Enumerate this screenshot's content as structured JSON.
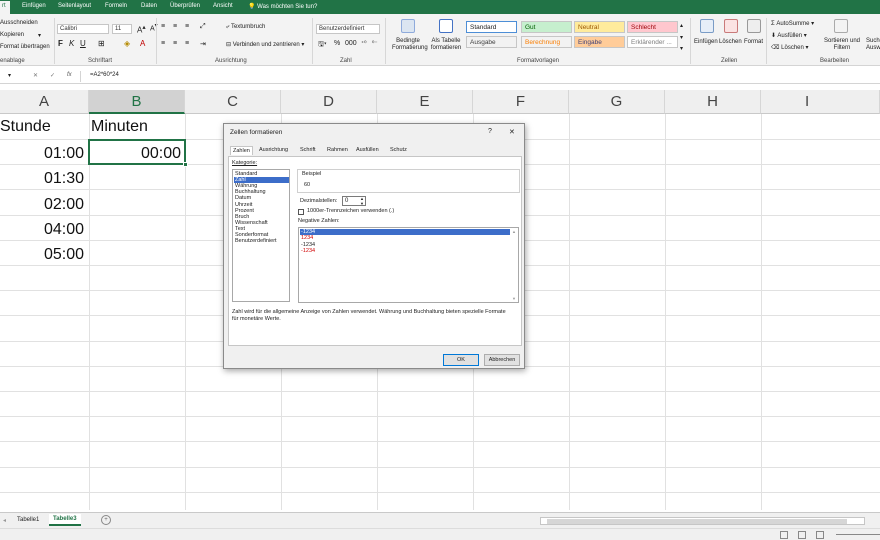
{
  "ribbon_tabs": [
    "rt",
    "Einfügen",
    "Seitenlayout",
    "Formeln",
    "Daten",
    "Überprüfen",
    "Ansicht"
  ],
  "tell_me": "Was möchten Sie tun?",
  "clipboard": {
    "cut": "Ausschneiden",
    "copy": "Kopieren",
    "format_painter": "Format übertragen",
    "label": "enablage"
  },
  "font": {
    "name": "Calibri",
    "size": "11",
    "label": "Schriftart"
  },
  "alignment": {
    "wrap": "Textumbruch",
    "merge": "Verbinden und zentrieren",
    "label": "Ausrichtung"
  },
  "number": {
    "format": "Benutzerdefiniert",
    "label": "Zahl"
  },
  "styles": {
    "conditional": "Bedingte Formatierung",
    "as_table": "Als Tabelle formatieren",
    "cells": [
      {
        "name": "Standard",
        "bg": "#ffffff",
        "fg": "#222222"
      },
      {
        "name": "Gut",
        "bg": "#c6efce",
        "fg": "#006100"
      },
      {
        "name": "Neutral",
        "bg": "#ffeb9c",
        "fg": "#9c5700"
      },
      {
        "name": "Schlecht",
        "bg": "#ffc7ce",
        "fg": "#9c0006"
      },
      {
        "name": "Ausgabe",
        "bg": "#f2f2f2",
        "fg": "#3f3f3f"
      },
      {
        "name": "Berechnung",
        "bg": "#f2f2f2",
        "fg": "#fa7d00"
      },
      {
        "name": "Eingabe",
        "bg": "#ffcc99",
        "fg": "#3f3f76"
      },
      {
        "name": "Erklärender ...",
        "bg": "#ffffff",
        "fg": "#7f7f7f"
      }
    ],
    "label": "Formatvorlagen"
  },
  "cells_group": {
    "insert": "Einfügen",
    "delete": "Löschen",
    "format": "Format",
    "label": "Zellen"
  },
  "editing": {
    "autosum": "AutoSumme",
    "fill": "Ausfüllen",
    "clear": "Löschen",
    "sort": "Sortieren und Filtern",
    "find": "Suche Ausw",
    "label": "Bearbeiten"
  },
  "formula_bar": {
    "formula": "=A2*60*24",
    "fx": "fx"
  },
  "columns": [
    "A",
    "B",
    "C",
    "D",
    "E",
    "F",
    "G",
    "H",
    "I"
  ],
  "sheet": {
    "header_a": "Stunde",
    "header_b": "Minuten",
    "col_a": [
      "01:00",
      "01:30",
      "02:00",
      "04:00",
      "05:00"
    ],
    "b2": "00:00"
  },
  "sheet_tabs": [
    "Tabelle1",
    "Tabelle3"
  ],
  "dialog": {
    "title": "Zellen formatieren",
    "help": "?",
    "close": "✕",
    "tabs": [
      "Zahlen",
      "Ausrichtung",
      "Schrift",
      "Rahmen",
      "Ausfüllen",
      "Schutz"
    ],
    "category_label": "Kategorie:",
    "categories": [
      "Standard",
      "Zahl",
      "Währung",
      "Buchhaltung",
      "Datum",
      "Uhrzeit",
      "Prozent",
      "Bruch",
      "Wissenschaft",
      "Text",
      "Sonderformat",
      "Benutzerdefiniert"
    ],
    "selected_category": 1,
    "sample_label": "Beispiel",
    "sample_value": "60",
    "decimals_label": "Dezimalstellen:",
    "decimals_value": "0",
    "thousands_label": "1000er-Trennzeichen verwenden (.)",
    "negative_label": "Negative Zahlen:",
    "negatives": [
      {
        "text": "-1234",
        "color": "#ffffff"
      },
      {
        "text": "1234",
        "color": "#d00000"
      },
      {
        "text": "-1234",
        "color": "#222222"
      },
      {
        "text": "-1234",
        "color": "#d00000"
      }
    ],
    "description": "Zahl wird für die allgemeine Anzeige von Zahlen verwendet. Währung und Buchhaltung bieten spezielle Formate für monetäre Werte.",
    "ok": "OK",
    "cancel": "Abbrechen"
  },
  "colors": {
    "excel_green": "#217346",
    "selection_blue": "#3c6dc9"
  }
}
